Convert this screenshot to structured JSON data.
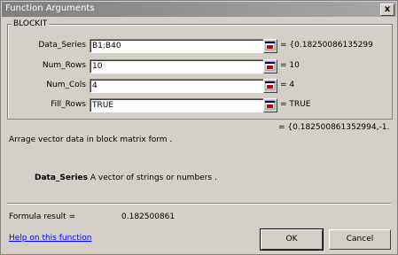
{
  "window": {
    "title": "Function Arguments",
    "close_label": "x"
  },
  "function": {
    "name": "BLOCKIT"
  },
  "arguments": [
    {
      "label": "Data_Series",
      "value": "B1:B40",
      "result": "= {0.18250086135299"
    },
    {
      "label": "Num_Rows",
      "value": "10",
      "result": "= 10"
    },
    {
      "label": "Num_Cols",
      "value": "4",
      "result": "= 4"
    },
    {
      "label": "Fill_Rows",
      "value": "TRUE",
      "result": "= TRUE"
    }
  ],
  "function_result": "= {0.182500861352994,-1.",
  "description": "Arrage vector data in block matrix form .",
  "arg_help": {
    "name": "Data_Series",
    "text": " A vector of strings or numbers ."
  },
  "formula": {
    "label": "Formula result =",
    "value": "0.182500861"
  },
  "help_link": "Help on this function",
  "buttons": {
    "ok": "OK",
    "cancel": "Cancel"
  },
  "icon_names": {
    "collapse": "collapse-dialog-icon",
    "close": "close-icon"
  }
}
